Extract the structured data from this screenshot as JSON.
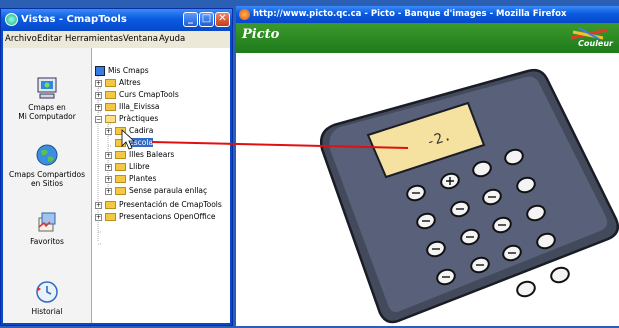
{
  "cmap_window": {
    "title": "Vistas - CmapTools",
    "menu": [
      "Archivo",
      "Editar",
      "Herramientas",
      "Ventana",
      "Ayuda"
    ],
    "side_items": [
      {
        "label_line1": "Cmaps en",
        "label_line2": "Mi Computador",
        "icon": "computer-icon"
      },
      {
        "label_line1": "Cmaps Compartidos",
        "label_line2": "en Sitios",
        "icon": "globe-icon"
      },
      {
        "label_line1": "Favoritos",
        "label_line2": "",
        "icon": "favorites-icon"
      },
      {
        "label_line1": "Historial",
        "label_line2": "",
        "icon": "history-icon"
      }
    ],
    "tree": {
      "root": "Mis Cmaps",
      "items": [
        "Altres",
        "Curs CmapTools",
        "Illa_Eivissa",
        "Pràctiques",
        "Cadira",
        "Escola",
        "Illes Balears",
        "Llibre",
        "Plantes",
        "Sense paraula enllaç",
        "Presentación de CmapTools",
        "Presentacions OpenOffice"
      ]
    }
  },
  "firefox_window": {
    "title": "http://www.picto.qc.ca - Picto - Banque d'images - Mozilla Firefox",
    "logo": "Picto",
    "couleur": "Couleur",
    "calc_display": "-2."
  },
  "colors": {
    "xp_blue": "#0a5be0",
    "picto_green": "#2a8a24",
    "drag_line": "#e01010"
  }
}
